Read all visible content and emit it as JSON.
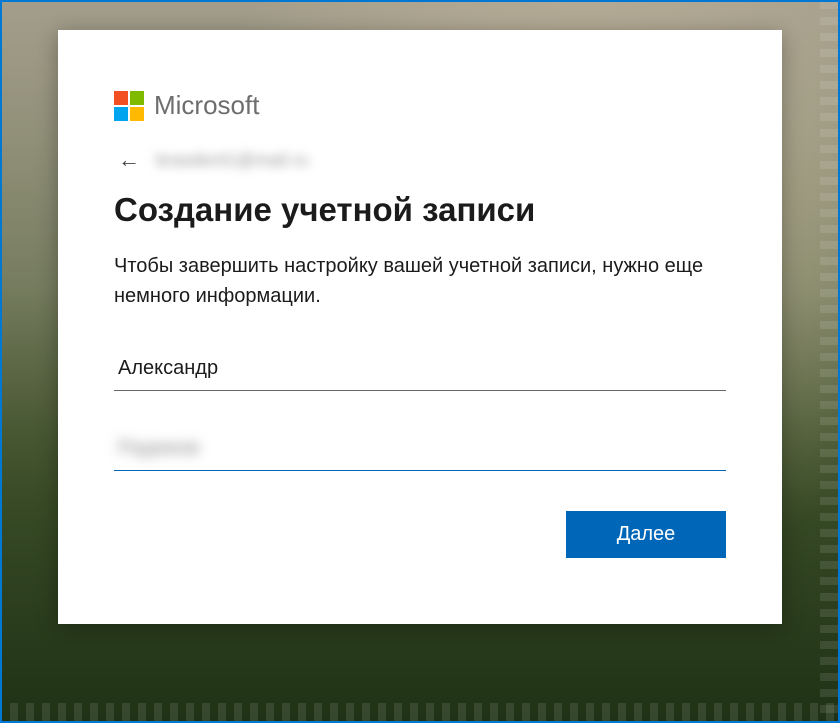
{
  "brand": {
    "name": "Microsoft"
  },
  "back": {
    "email_masked": "brasdent1@mail.ru"
  },
  "dialog": {
    "heading": "Создание учетной записи",
    "subtext": "Чтобы завершить настройку вашей учетной записи, нужно еще немного информации."
  },
  "form": {
    "first_name_value": "Александр",
    "last_name_masked": "Радюков"
  },
  "actions": {
    "next_label": "Далее"
  },
  "colors": {
    "accent": "#0067b8",
    "frame": "#0078d4"
  }
}
